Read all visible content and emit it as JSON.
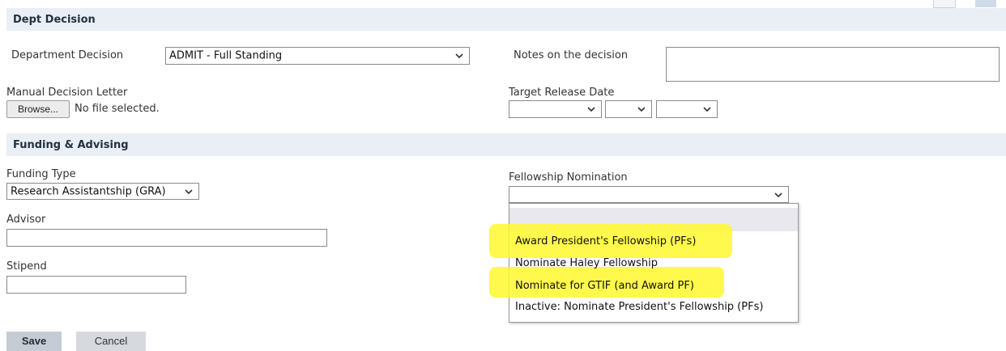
{
  "sections": {
    "dept_decision": "Dept Decision",
    "funding_advising": "Funding & Advising"
  },
  "dept": {
    "decision_label": "Department Decision",
    "decision_value": "ADMIT - Full Standing",
    "notes_label": "Notes on the decision",
    "notes_value": "",
    "manual_letter_label": "Manual Decision Letter",
    "browse_label": "Browse...",
    "file_status": "No file selected.",
    "target_release_label": "Target Release Date",
    "release_month": "",
    "release_day": "",
    "release_year": ""
  },
  "funding": {
    "funding_type_label": "Funding Type",
    "funding_type_value": "Research Assistantship (GRA)",
    "advisor_label": "Advisor",
    "advisor_value": "",
    "stipend_label": "Stipend",
    "stipend_value": "",
    "fellowship_label": "Fellowship Nomination",
    "fellowship_value": "",
    "fellowship_options": [
      "",
      "Award President's Fellowship (PFs)",
      "Nominate Haley Fellowship",
      "Nominate for GTIF (and Award PF)",
      "Inactive: Nominate President's Fellowship (PFs)"
    ],
    "highlighted_options": [
      1,
      3
    ]
  },
  "actions": {
    "save_label": "Save",
    "cancel_label": "Cancel"
  },
  "colors": {
    "section_bg": "#e9eff5",
    "highlight": "#fff82e",
    "save_bg": "#c6ccd4"
  }
}
